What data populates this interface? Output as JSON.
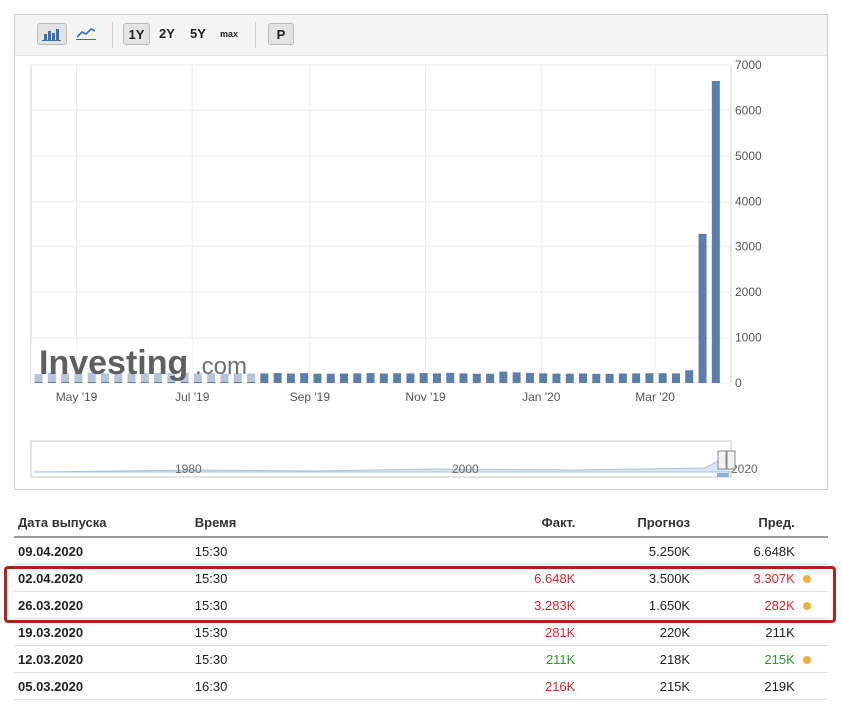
{
  "toolbar": {
    "bar_chart_icon": "bar-chart-icon",
    "line_chart_icon": "line-chart-icon",
    "range_1y": "1Y",
    "range_2y": "2Y",
    "range_5y": "5Y",
    "range_max": "max",
    "p_label": "P"
  },
  "watermark": {
    "brand": "Investing",
    "suffix": ".com"
  },
  "navigator": {
    "labels": [
      "1980",
      "2000",
      "2020"
    ]
  },
  "chart_data": {
    "type": "bar",
    "x": [
      "2019-04-11",
      "2019-04-18",
      "2019-04-25",
      "2019-05-02",
      "2019-05-09",
      "2019-05-16",
      "2019-05-23",
      "2019-05-30",
      "2019-06-06",
      "2019-06-13",
      "2019-06-20",
      "2019-06-27",
      "2019-07-04",
      "2019-07-11",
      "2019-07-18",
      "2019-07-25",
      "2019-08-01",
      "2019-08-08",
      "2019-08-15",
      "2019-08-22",
      "2019-08-29",
      "2019-09-05",
      "2019-09-12",
      "2019-09-19",
      "2019-09-26",
      "2019-10-03",
      "2019-10-10",
      "2019-10-17",
      "2019-10-24",
      "2019-10-31",
      "2019-11-07",
      "2019-11-14",
      "2019-11-21",
      "2019-11-28",
      "2019-12-05",
      "2019-12-12",
      "2019-12-19",
      "2019-12-26",
      "2020-01-02",
      "2020-01-09",
      "2020-01-16",
      "2020-01-23",
      "2020-01-30",
      "2020-02-06",
      "2020-02-13",
      "2020-02-20",
      "2020-02-27",
      "2020-03-05",
      "2020-03-12",
      "2020-03-19",
      "2020-03-26",
      "2020-04-02"
    ],
    "values": [
      196,
      230,
      211,
      230,
      228,
      212,
      211,
      215,
      218,
      222,
      216,
      221,
      209,
      216,
      206,
      217,
      209,
      211,
      220,
      209,
      217,
      204,
      204,
      208,
      213,
      219,
      210,
      214,
      212,
      218,
      211,
      223,
      213,
      203,
      203,
      252,
      234,
      222,
      214,
      207,
      204,
      211,
      201,
      202,
      210,
      211,
      216,
      216,
      211,
      281,
      3283,
      6648
    ],
    "x_tick_labels": [
      "May '19",
      "Jul '19",
      "Sep '19",
      "Nov '19",
      "Jan '20",
      "Mar '20"
    ],
    "y_ticks": [
      0,
      1000,
      2000,
      3000,
      4000,
      5000,
      6000,
      7000
    ],
    "ylim": [
      0,
      7000
    ],
    "grid": true,
    "y_axis_side": "right",
    "bar_color": "#5b7fa8"
  },
  "table": {
    "headers": {
      "date": "Дата выпуска",
      "time": "Время",
      "actual": "Факт.",
      "forecast": "Прогноз",
      "previous": "Пред."
    },
    "rows": [
      {
        "date": "09.04.2020",
        "time": "15:30",
        "actual": "",
        "actual_color": "",
        "forecast": "5.250K",
        "previous": "6.648K",
        "previous_color": "",
        "revised": false
      },
      {
        "date": "02.04.2020",
        "time": "15:30",
        "actual": "6.648K",
        "actual_color": "red",
        "forecast": "3.500K",
        "previous": "3.307K",
        "previous_color": "red",
        "revised": true
      },
      {
        "date": "26.03.2020",
        "time": "15:30",
        "actual": "3.283K",
        "actual_color": "red",
        "forecast": "1.650K",
        "previous": "282K",
        "previous_color": "red",
        "revised": true
      },
      {
        "date": "19.03.2020",
        "time": "15:30",
        "actual": "281K",
        "actual_color": "red",
        "forecast": "220K",
        "previous": "211K",
        "previous_color": "",
        "revised": false
      },
      {
        "date": "12.03.2020",
        "time": "15:30",
        "actual": "211K",
        "actual_color": "green",
        "forecast": "218K",
        "previous": "215K",
        "previous_color": "green",
        "revised": true
      },
      {
        "date": "05.03.2020",
        "time": "16:30",
        "actual": "216K",
        "actual_color": "red",
        "forecast": "215K",
        "previous": "219K",
        "previous_color": "",
        "revised": false
      }
    ]
  },
  "colors": {
    "highlight": "#b32219",
    "red": "#d9262b",
    "green": "#2d9a2d",
    "dot": "#e8b23c"
  }
}
